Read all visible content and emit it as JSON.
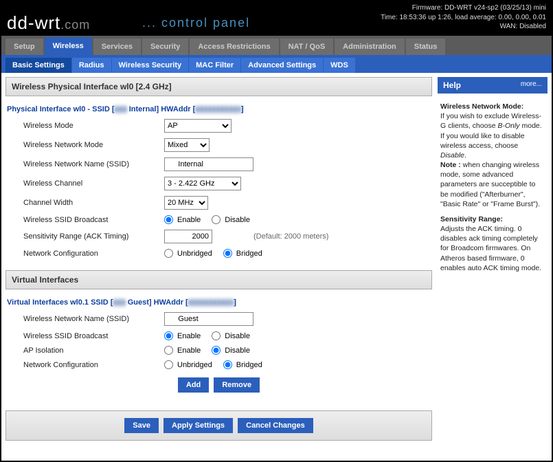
{
  "status": {
    "firmware": "Firmware: DD-WRT v24-sp2 (03/25/13) mini",
    "time": "Time: 18:53:36 up 1:26, load average: 0.00, 0.00, 0.01",
    "wan": "WAN: Disabled"
  },
  "logo": {
    "brand": "dd-wrt",
    "suffix": ".com",
    "cp": "... control panel"
  },
  "tabs": [
    "Setup",
    "Wireless",
    "Services",
    "Security",
    "Access Restrictions",
    "NAT / QoS",
    "Administration",
    "Status"
  ],
  "subtabs": [
    "Basic Settings",
    "Radius",
    "Wireless Security",
    "MAC Filter",
    "Advanced Settings",
    "WDS"
  ],
  "section1": {
    "title": "Wireless Physical Interface wl0 [2.4 GHz]",
    "iface_prefix": "Physical Interface wl0 - SSID [",
    "iface_ssid_blur": "▮▮▮",
    "iface_ssid_suffix": " Internal] HWAddr [",
    "iface_hw_blur": "▮▮▮▮▮▮▮▮▮▮▮",
    "iface_close": "]",
    "fields": {
      "mode_lbl": "Wireless Mode",
      "mode_val": "AP",
      "netmode_lbl": "Wireless Network Mode",
      "netmode_val": "Mixed",
      "ssid_lbl": "Wireless Network Name (SSID)",
      "ssid_val": "     Internal",
      "chan_lbl": "Wireless Channel",
      "chan_val": "3 - 2.422 GHz",
      "width_lbl": "Channel Width",
      "width_val": "20 MHz",
      "bcast_lbl": "Wireless SSID Broadcast",
      "sens_lbl": "Sensitivity Range (ACK Timing)",
      "sens_val": "2000",
      "sens_hint": "(Default: 2000 meters)",
      "netcfg_lbl": "Network Configuration"
    }
  },
  "section2": {
    "title": "Virtual Interfaces",
    "iface_prefix": "Virtual Interfaces wl0.1 SSID [",
    "iface_ssid_blur": "▮▮▮",
    "iface_ssid_suffix": " Guest] HWAddr [",
    "iface_hw_blur": "▮▮▮▮▮▮▮▮▮▮▮",
    "iface_close": "]",
    "fields": {
      "ssid_lbl": "Wireless Network Name (SSID)",
      "ssid_val": "     Guest",
      "bcast_lbl": "Wireless SSID Broadcast",
      "apiso_lbl": "AP Isolation",
      "netcfg_lbl": "Network Configuration"
    }
  },
  "radios": {
    "enable": "Enable",
    "disable": "Disable",
    "unbridged": "Unbridged",
    "bridged": "Bridged"
  },
  "buttons": {
    "add": "Add",
    "remove": "Remove",
    "save": "Save",
    "apply": "Apply Settings",
    "cancel": "Cancel Changes"
  },
  "help": {
    "title": "Help",
    "more": "more...",
    "h1": "Wireless Network Mode:",
    "p1a": "If you wish to exclude Wireless-G clients, choose ",
    "p1b": "B-Only",
    "p1c": " mode. If you would like to disable wireless access, choose ",
    "p1d": "Disable",
    "p1e": ".",
    "note_lbl": "Note :",
    "note": " when changing wireless mode, some advanced parameters are succeptible to be modified (\"Afterburner\", \"Basic Rate\" or \"Frame Burst\").",
    "h2": "Sensitivity Range:",
    "p2": "Adjusts the ACK timing. 0 disables ack timing completely for Broadcom firmwares. On Atheros based firmware, 0 enables auto ACK timing mode."
  }
}
